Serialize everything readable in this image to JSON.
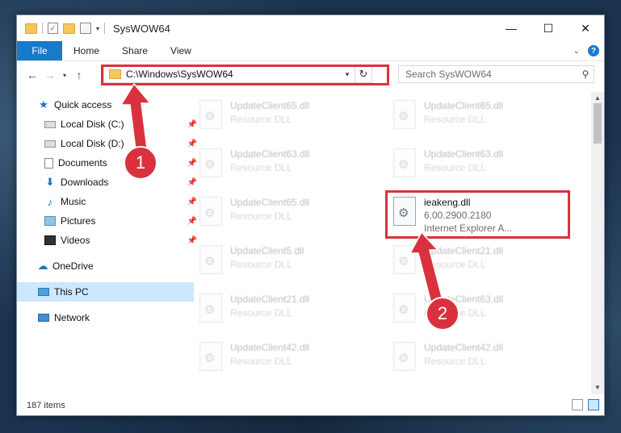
{
  "window": {
    "title": "SysWOW64",
    "minimize": "—",
    "maximize": "☐",
    "close": "✕"
  },
  "ribbon": {
    "tabs": [
      "File",
      "Home",
      "Share",
      "View"
    ],
    "help": "?"
  },
  "nav": {
    "back": "←",
    "forward": "→",
    "recent": "▾",
    "up": "↑",
    "address": "C:\\Windows\\SysWOW64",
    "refresh": "↻",
    "search_placeholder": "Search SysWOW64"
  },
  "sidebar": {
    "items": [
      {
        "label": "Quick access",
        "icon": "star-icon"
      },
      {
        "label": "Local Disk (C:)",
        "icon": "drive-icon",
        "pinned": true
      },
      {
        "label": "Local Disk (D:)",
        "icon": "drive-icon",
        "pinned": true
      },
      {
        "label": "Documents",
        "icon": "documents-icon",
        "pinned": true
      },
      {
        "label": "Downloads",
        "icon": "download-icon",
        "pinned": true
      },
      {
        "label": "Music",
        "icon": "music-icon",
        "pinned": true
      },
      {
        "label": "Pictures",
        "icon": "pictures-icon",
        "pinned": true
      },
      {
        "label": "Videos",
        "icon": "videos-icon",
        "pinned": true
      },
      {
        "label": "OneDrive",
        "icon": "cloud-icon"
      },
      {
        "label": "This PC",
        "icon": "computer-icon",
        "selected": true
      },
      {
        "label": "Network",
        "icon": "network-icon"
      }
    ]
  },
  "files": [
    {
      "name": "UpdateClient65.dll",
      "type": "Resource DLL",
      "faded": true
    },
    {
      "name": "UpdateClient65.dll",
      "type": "Resource DLL",
      "faded": true
    },
    {
      "name": "UpdateClient63.dll",
      "type": "Resource DLL",
      "faded": true
    },
    {
      "name": "UpdateClient63.dll",
      "type": "Resource DLL",
      "faded": true
    },
    {
      "name": "UpdateClient65.dll",
      "type": "Resource DLL",
      "faded": true
    },
    {
      "name": "ieakeng.dll",
      "version": "6.00.2900.2180",
      "description": "Internet Explorer A...",
      "faded": false
    },
    {
      "name": "UpdateClient5.dll",
      "type": "Resource DLL",
      "faded": true
    },
    {
      "name": "UpdateClient21.dll",
      "type": "Resource DLL",
      "faded": true
    },
    {
      "name": "UpdateClient21.dll",
      "type": "Resource DLL",
      "faded": true
    },
    {
      "name": "UpdateClient63.dll",
      "type": "Resource DLL",
      "faded": true
    },
    {
      "name": "UpdateClient42.dll",
      "type": "Resource DLL",
      "faded": true
    },
    {
      "name": "UpdateClient42.dll",
      "type": "Resource DLL",
      "faded": true
    }
  ],
  "status": {
    "item_count": "187 items"
  },
  "annotations": {
    "step1": "1",
    "step2": "2",
    "color": "#d9323e"
  }
}
